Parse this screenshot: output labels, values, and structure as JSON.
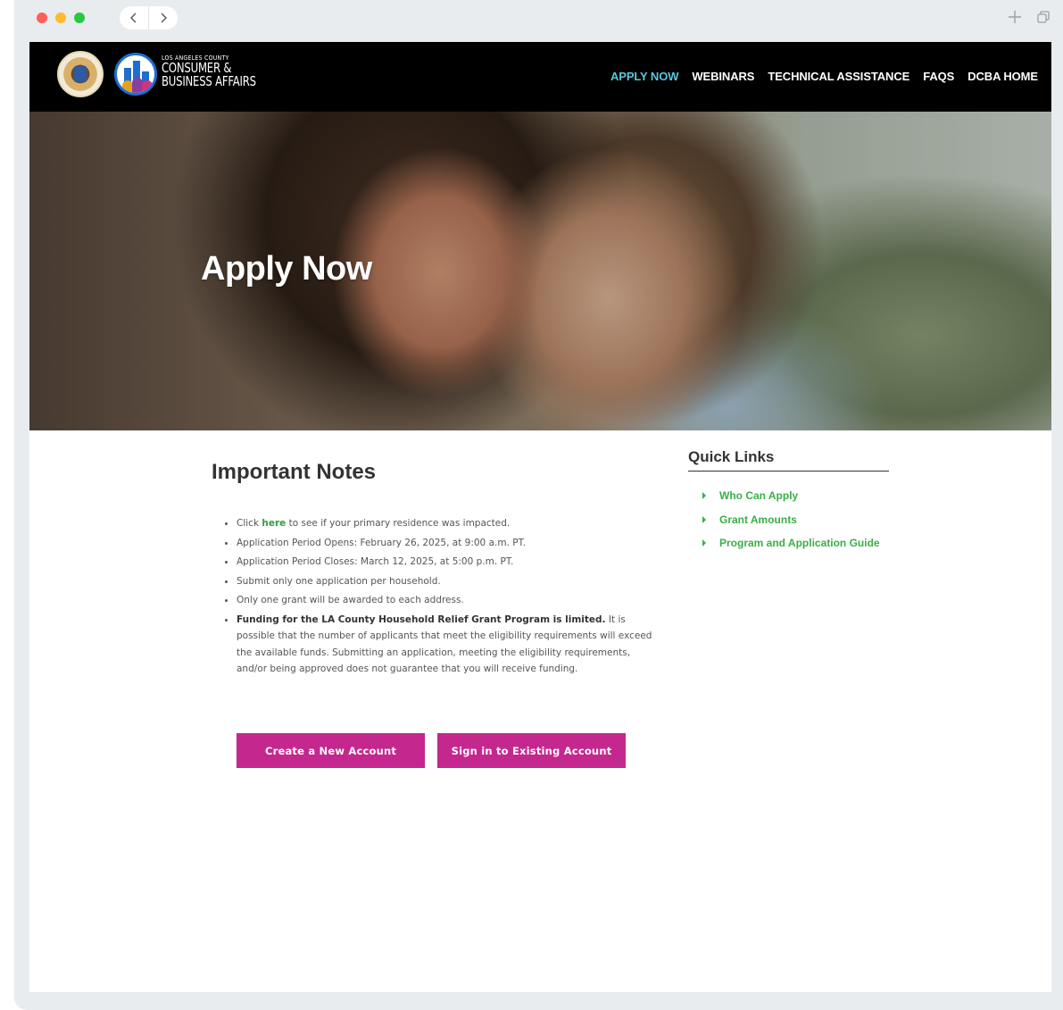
{
  "topbar": {
    "brand_small": "LOS ANGELES COUNTY",
    "brand_line1": "CONSUMER &",
    "brand_line2": "BUSINESS AFFAIRS"
  },
  "nav": {
    "items": [
      {
        "label": "APPLY NOW",
        "active": true
      },
      {
        "label": "WEBINARS"
      },
      {
        "label": "TECHNICAL ASSISTANCE"
      },
      {
        "label": "FAQS"
      },
      {
        "label": "DCBA HOME"
      }
    ]
  },
  "hero": {
    "title": "Apply Now"
  },
  "notes": {
    "title": "Important Notes",
    "item0_pre": "Click ",
    "item0_link": "here",
    "item0_post": " to see if your primary residence was impacted.",
    "item1": "Application Period Opens: February 26, 2025, at 9:00 a.m. PT.",
    "item2": "Application Period Closes: March 12, 2025, at 5:00 p.m. PT.",
    "item3": "Submit only one application per household.",
    "item4": "Only one grant will be awarded to each address.",
    "item5_bold": "Funding for the LA County Household Relief Grant Program is limited.",
    "item5_rest": " It is possible that the number of applicants that meet the eligibility requirements will exceed the available funds. Submitting an application, meeting the eligibility requirements, and/or being approved does not guarantee that you will receive funding."
  },
  "buttons": {
    "create": "Create a New Account",
    "signin": "Sign in to Existing Account"
  },
  "quick_links": {
    "title": "Quick Links",
    "items": [
      "Who Can Apply",
      "Grant Amounts",
      "Program and Application Guide"
    ]
  },
  "colors": {
    "accent_magenta": "#c4278e",
    "link_green": "#3aae48",
    "nav_active": "#5bc6e0"
  },
  "icons": {
    "back": "chevron-left-icon",
    "forward": "chevron-right-icon",
    "new_tab": "plus-icon",
    "window": "window-restore-icon"
  }
}
